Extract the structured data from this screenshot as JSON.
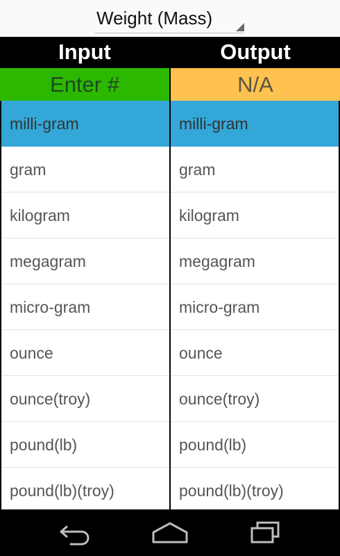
{
  "spinner": {
    "selected": "Weight (Mass)"
  },
  "header": {
    "input_label": "Input",
    "output_label": "Output"
  },
  "input_field": {
    "placeholder": "Enter #"
  },
  "output_field": {
    "value": "N/A"
  },
  "units": [
    "milli-gram",
    "gram",
    "kilogram",
    "megagram",
    "micro-gram",
    "ounce",
    "ounce(troy)",
    "pound(lb)",
    "pound(lb)(troy)"
  ],
  "selected_input_index": 0,
  "selected_output_index": 0,
  "nav": {
    "back_icon": "back-icon",
    "home_icon": "home-icon",
    "recents_icon": "recents-icon"
  },
  "colors": {
    "input_bg": "#2db800",
    "output_bg": "#ffc14f",
    "selected_bg": "#33a8d8"
  }
}
